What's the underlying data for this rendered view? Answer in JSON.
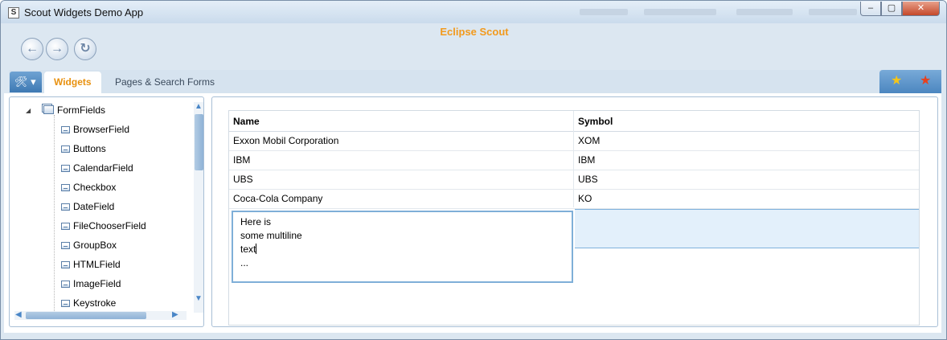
{
  "window": {
    "icon_letter": "S",
    "title": "Scout Widgets Demo App",
    "controls": {
      "minimize": "–",
      "maximize": "▢",
      "close": "✕"
    }
  },
  "header": {
    "brand": "Eclipse Scout",
    "nav": {
      "back": "←",
      "forward": "→",
      "refresh": "↻"
    }
  },
  "tabs": {
    "tools_label": "🛠 ▾",
    "items": [
      {
        "label": "Widgets",
        "active": true
      },
      {
        "label": "Pages & Search Forms",
        "active": false
      }
    ],
    "bookmark_icons": {
      "add": "★",
      "manage": "★"
    },
    "colors": {
      "active_tab_text": "#e8910f",
      "add_star": "#f5c518",
      "manage_star": "#e8401c"
    }
  },
  "tree": {
    "root": {
      "label": "FormFields",
      "expanded": true
    },
    "items": [
      "BrowserField",
      "Buttons",
      "CalendarField",
      "Checkbox",
      "DateField",
      "FileChooserField",
      "GroupBox",
      "HTMLField",
      "ImageField",
      "Keystroke"
    ]
  },
  "table": {
    "columns": [
      "Name",
      "Symbol"
    ],
    "rows": [
      [
        "Exxon Mobil Corporation",
        "XOM"
      ],
      [
        "IBM",
        "IBM"
      ],
      [
        "UBS",
        "UBS"
      ],
      [
        "Coca-Cola Company",
        "KO"
      ]
    ],
    "editor_lines": [
      "Here is",
      "some multiline",
      "text",
      "..."
    ]
  }
}
